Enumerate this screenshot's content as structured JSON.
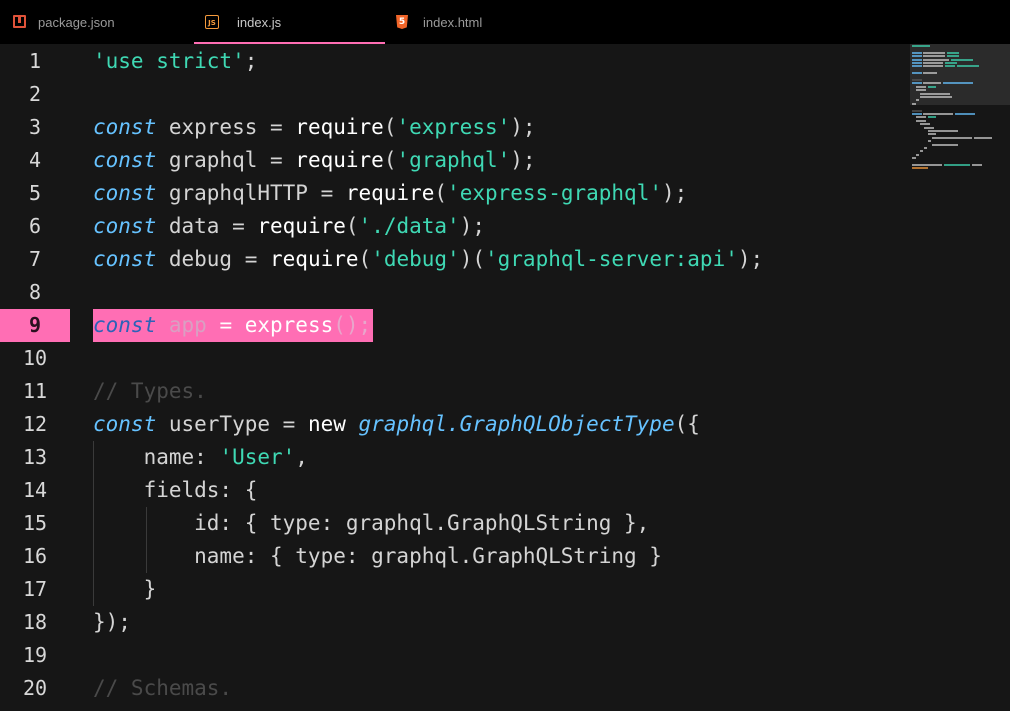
{
  "tabs": [
    {
      "label": "package.json",
      "icon": "package-icon",
      "active": false
    },
    {
      "label": "index.js",
      "icon": "js-file-icon",
      "active": true
    },
    {
      "label": "index.html",
      "icon": "html-file-icon",
      "active": false
    }
  ],
  "editor": {
    "highlighted_line": 9,
    "line_numbers": [
      "1",
      "2",
      "3",
      "4",
      "5",
      "6",
      "7",
      "8",
      "9",
      "10",
      "11",
      "12",
      "13",
      "14",
      "15",
      "16",
      "17",
      "18",
      "19",
      "20"
    ],
    "lines": [
      {
        "n": "1",
        "tokens": [
          {
            "t": "str",
            "v": "'use strict'"
          },
          {
            "t": "id",
            "v": ";"
          }
        ]
      },
      {
        "n": "2",
        "tokens": []
      },
      {
        "n": "3",
        "tokens": [
          {
            "t": "kw",
            "v": "const"
          },
          {
            "t": "id",
            "v": " express = "
          },
          {
            "t": "fn",
            "v": "require"
          },
          {
            "t": "id",
            "v": "("
          },
          {
            "t": "str",
            "v": "'express'"
          },
          {
            "t": "id",
            "v": ");"
          }
        ]
      },
      {
        "n": "4",
        "tokens": [
          {
            "t": "kw",
            "v": "const"
          },
          {
            "t": "id",
            "v": " graphql = "
          },
          {
            "t": "fn",
            "v": "require"
          },
          {
            "t": "id",
            "v": "("
          },
          {
            "t": "str",
            "v": "'graphql'"
          },
          {
            "t": "id",
            "v": ");"
          }
        ]
      },
      {
        "n": "5",
        "tokens": [
          {
            "t": "kw",
            "v": "const"
          },
          {
            "t": "id",
            "v": " graphqlHTTP = "
          },
          {
            "t": "fn",
            "v": "require"
          },
          {
            "t": "id",
            "v": "("
          },
          {
            "t": "str",
            "v": "'express-graphql'"
          },
          {
            "t": "id",
            "v": ");"
          }
        ]
      },
      {
        "n": "6",
        "tokens": [
          {
            "t": "kw",
            "v": "const"
          },
          {
            "t": "id",
            "v": " data = "
          },
          {
            "t": "fn",
            "v": "require"
          },
          {
            "t": "id",
            "v": "("
          },
          {
            "t": "str",
            "v": "'./data'"
          },
          {
            "t": "id",
            "v": ");"
          }
        ]
      },
      {
        "n": "7",
        "tokens": [
          {
            "t": "kw",
            "v": "const"
          },
          {
            "t": "id",
            "v": " debug = "
          },
          {
            "t": "fn",
            "v": "require"
          },
          {
            "t": "id",
            "v": "("
          },
          {
            "t": "str",
            "v": "'debug'"
          },
          {
            "t": "id",
            "v": ")("
          },
          {
            "t": "str",
            "v": "'graphql-server:api'"
          },
          {
            "t": "id",
            "v": ");"
          }
        ]
      },
      {
        "n": "8",
        "tokens": []
      },
      {
        "n": "9",
        "tokens": [
          {
            "t": "kw",
            "v": "const"
          },
          {
            "t": "id",
            "v": " app "
          },
          {
            "t": "fn",
            "v": "= express"
          },
          {
            "t": "pn",
            "v": "();"
          }
        ]
      },
      {
        "n": "10",
        "tokens": []
      },
      {
        "n": "11",
        "tokens": [
          {
            "t": "cm",
            "v": "// Types."
          }
        ]
      },
      {
        "n": "12",
        "tokens": [
          {
            "t": "kw",
            "v": "const"
          },
          {
            "t": "id",
            "v": " userType = "
          },
          {
            "t": "fn",
            "v": "new "
          },
          {
            "t": "cls",
            "v": "graphql.GraphQLObjectType"
          },
          {
            "t": "id",
            "v": "({"
          }
        ]
      },
      {
        "n": "13",
        "tokens": [
          {
            "t": "id",
            "v": "    name: "
          },
          {
            "t": "str",
            "v": "'User'"
          },
          {
            "t": "id",
            "v": ","
          }
        ]
      },
      {
        "n": "14",
        "tokens": [
          {
            "t": "id",
            "v": "    fields: {"
          }
        ]
      },
      {
        "n": "15",
        "tokens": [
          {
            "t": "id",
            "v": "        id: { type: graphql.GraphQLString },"
          }
        ]
      },
      {
        "n": "16",
        "tokens": [
          {
            "t": "id",
            "v": "        name: { type: graphql.GraphQLString }"
          }
        ]
      },
      {
        "n": "17",
        "tokens": [
          {
            "t": "id",
            "v": "    }"
          }
        ]
      },
      {
        "n": "18",
        "tokens": [
          {
            "t": "id",
            "v": "});"
          }
        ]
      },
      {
        "n": "19",
        "tokens": []
      },
      {
        "n": "20",
        "tokens": [
          {
            "t": "cm",
            "v": "// Schemas."
          }
        ]
      }
    ]
  },
  "colors": {
    "accent": "#ff6eb4",
    "background": "#161616",
    "tabbar": "#000000",
    "keyword": "#66c2ff",
    "string": "#3fd9b4",
    "comment": "#4a4a4a"
  }
}
